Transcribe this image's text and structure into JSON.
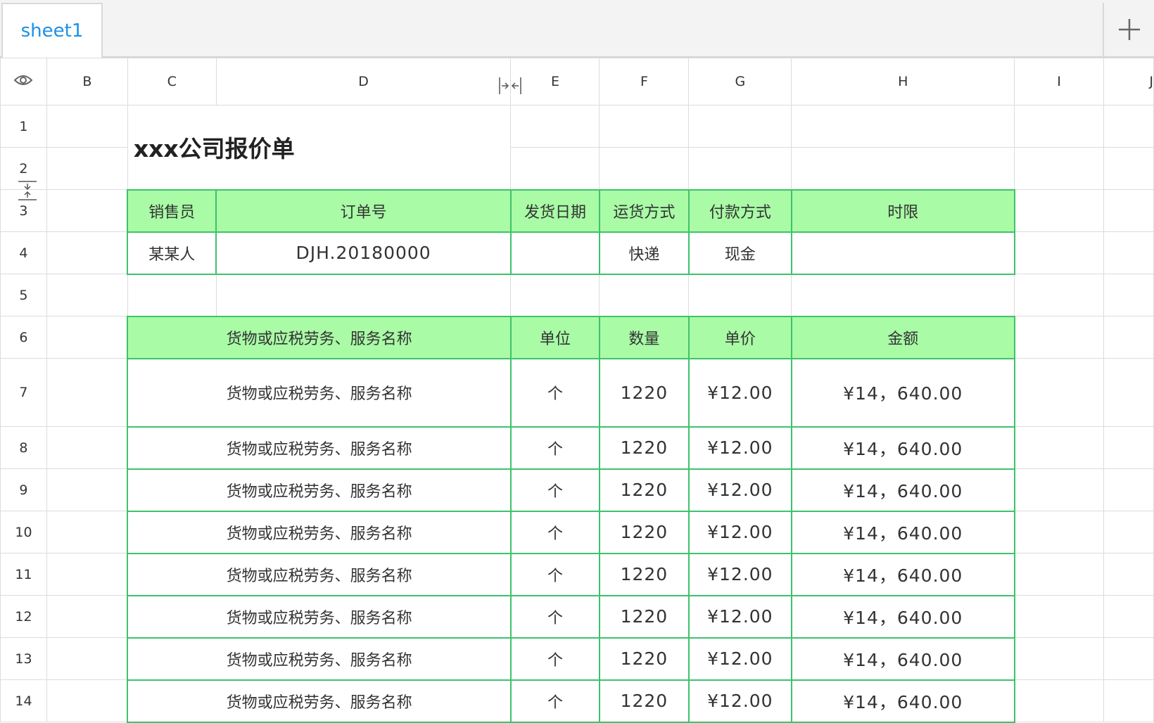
{
  "tabs": {
    "active": "sheet1",
    "add_icon": "plus-icon"
  },
  "columns": [
    "B",
    "C",
    "D",
    "E",
    "F",
    "G",
    "H",
    "I",
    "J"
  ],
  "rows": [
    "1",
    "2",
    "3",
    "4",
    "5",
    "6",
    "7",
    "8",
    "9",
    "10",
    "11",
    "12",
    "13",
    "14"
  ],
  "title": "xxx公司报价单",
  "order_header": {
    "salesperson": "销售员",
    "order_no": "订单号",
    "ship_date": "发货日期",
    "shipping": "运货方式",
    "payment": "付款方式",
    "deadline": "时限"
  },
  "order_values": {
    "salesperson": "某某人",
    "order_no": "DJH.20180000",
    "ship_date": "",
    "shipping": "快递",
    "payment": "现金",
    "deadline": ""
  },
  "item_header": {
    "name": "货物或应税劳务、服务名称",
    "unit": "单位",
    "qty": "数量",
    "price": "单价",
    "amount": "金额"
  },
  "items": [
    {
      "name": "货物或应税劳务、服务名称",
      "unit": "个",
      "qty": "1220",
      "price": "¥12.00",
      "amount": "¥14，640.00"
    },
    {
      "name": "货物或应税劳务、服务名称",
      "unit": "个",
      "qty": "1220",
      "price": "¥12.00",
      "amount": "¥14，640.00"
    },
    {
      "name": "货物或应税劳务、服务名称",
      "unit": "个",
      "qty": "1220",
      "price": "¥12.00",
      "amount": "¥14，640.00"
    },
    {
      "name": "货物或应税劳务、服务名称",
      "unit": "个",
      "qty": "1220",
      "price": "¥12.00",
      "amount": "¥14，640.00"
    },
    {
      "name": "货物或应税劳务、服务名称",
      "unit": "个",
      "qty": "1220",
      "price": "¥12.00",
      "amount": "¥14，640.00"
    },
    {
      "name": "货物或应税劳务、服务名称",
      "unit": "个",
      "qty": "1220",
      "price": "¥12.00",
      "amount": "¥14，640.00"
    },
    {
      "name": "货物或应税劳务、服务名称",
      "unit": "个",
      "qty": "1220",
      "price": "¥12.00",
      "amount": "¥14，640.00"
    },
    {
      "name": "货物或应税劳务、服务名称",
      "unit": "个",
      "qty": "1220",
      "price": "¥12.00",
      "amount": "¥14，640.00"
    }
  ],
  "colors": {
    "header_fill": "#a9fba6",
    "green_border": "#3dc36a",
    "tab_text": "#1e90e6"
  }
}
